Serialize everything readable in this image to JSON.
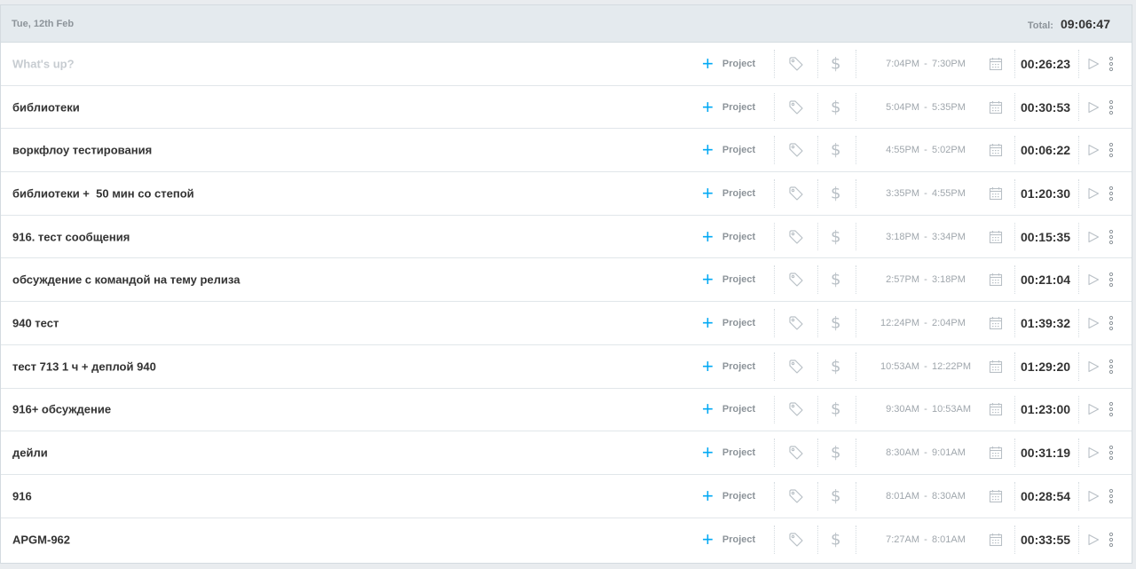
{
  "header": {
    "date": "Tue, 12th Feb",
    "total_label": "Total:",
    "total_value": "09:06:47"
  },
  "icons": {
    "add": "plus-icon",
    "tag": "tag-icon",
    "billable": "dollar-icon",
    "calendar": "calendar-icon",
    "play": "play-icon",
    "more": "more-vertical-icon"
  },
  "colors": {
    "accent": "#03a9f4",
    "header_bg": "#e4eaee",
    "text": "#333333",
    "muted": "#8d949a"
  },
  "entries": [
    {
      "description": "What's up?",
      "placeholder": true,
      "project": "Project",
      "start": "7:04PM",
      "dash": "-",
      "end": "7:30PM",
      "duration": "00:26:23"
    },
    {
      "description": "библиотеки",
      "placeholder": false,
      "project": "Project",
      "start": "5:04PM",
      "dash": "-",
      "end": "5:35PM",
      "duration": "00:30:53"
    },
    {
      "description": "воркфлоу тестирования",
      "placeholder": false,
      "project": "Project",
      "start": "4:55PM",
      "dash": "-",
      "end": "5:02PM",
      "duration": "00:06:22"
    },
    {
      "description": "библиотеки +  50 мин со степой",
      "placeholder": false,
      "project": "Project",
      "start": "3:35PM",
      "dash": "-",
      "end": "4:55PM",
      "duration": "01:20:30"
    },
    {
      "description": "916. тест сообщения",
      "placeholder": false,
      "project": "Project",
      "start": "3:18PM",
      "dash": "-",
      "end": "3:34PM",
      "duration": "00:15:35"
    },
    {
      "description": "обсуждение с командой на тему релиза",
      "placeholder": false,
      "project": "Project",
      "start": "2:57PM",
      "dash": "-",
      "end": "3:18PM",
      "duration": "00:21:04"
    },
    {
      "description": "940 тест",
      "placeholder": false,
      "project": "Project",
      "start": "12:24PM",
      "dash": "-",
      "end": "2:04PM",
      "duration": "01:39:32"
    },
    {
      "description": "тест 713 1 ч + деплой 940",
      "placeholder": false,
      "project": "Project",
      "start": "10:53AM",
      "dash": "-",
      "end": "12:22PM",
      "duration": "01:29:20"
    },
    {
      "description": "916+ обсуждение",
      "placeholder": false,
      "project": "Project",
      "start": "9:30AM",
      "dash": "-",
      "end": "10:53AM",
      "duration": "01:23:00"
    },
    {
      "description": "дейли",
      "placeholder": false,
      "project": "Project",
      "start": "8:30AM",
      "dash": "-",
      "end": "9:01AM",
      "duration": "00:31:19"
    },
    {
      "description": "916",
      "placeholder": false,
      "project": "Project",
      "start": "8:01AM",
      "dash": "-",
      "end": "8:30AM",
      "duration": "00:28:54"
    },
    {
      "description": "APGM-962",
      "placeholder": false,
      "project": "Project",
      "start": "7:27AM",
      "dash": "-",
      "end": "8:01AM",
      "duration": "00:33:55"
    }
  ]
}
